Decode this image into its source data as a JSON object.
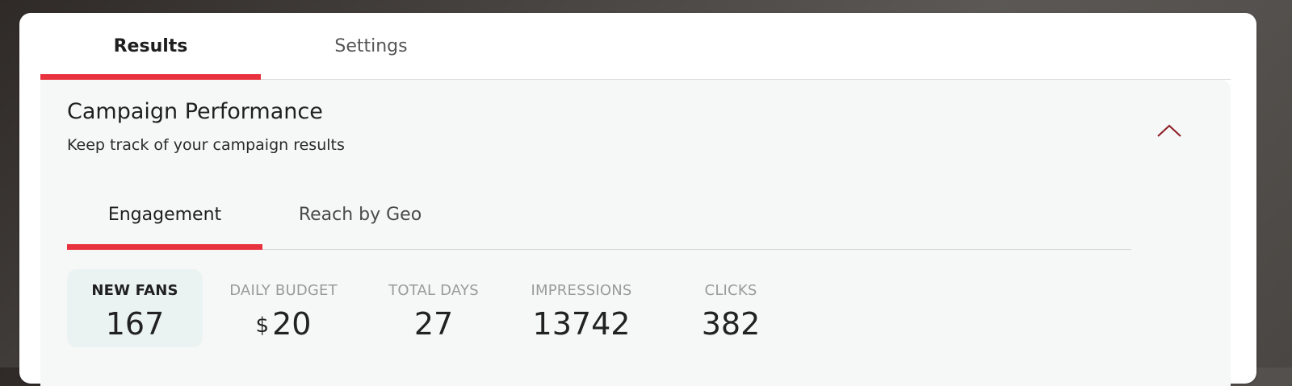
{
  "colors": {
    "accent": "#e8333f",
    "chevron": "#8b1a22",
    "panel_bg": "#f6f8f7",
    "selected_stat_bg": "#ebf3f2"
  },
  "top_tabs": [
    {
      "label": "Results",
      "active": true
    },
    {
      "label": "Settings",
      "active": false
    }
  ],
  "panel": {
    "title": "Campaign Performance",
    "subtitle": "Keep track of your campaign results",
    "collapse_icon": "chevron-up-icon"
  },
  "inner_tabs": [
    {
      "label": "Engagement",
      "active": true
    },
    {
      "label": "Reach by Geo",
      "active": false
    }
  ],
  "stats": [
    {
      "label": "NEW FANS",
      "value": "167",
      "selected": true
    },
    {
      "label": "DAILY BUDGET",
      "currency": "$",
      "value": "20",
      "selected": false
    },
    {
      "label": "TOTAL DAYS",
      "value": "27",
      "selected": false
    },
    {
      "label": "IMPRESSIONS",
      "value": "13742",
      "selected": false
    },
    {
      "label": "CLICKS",
      "value": "382",
      "selected": false
    }
  ]
}
